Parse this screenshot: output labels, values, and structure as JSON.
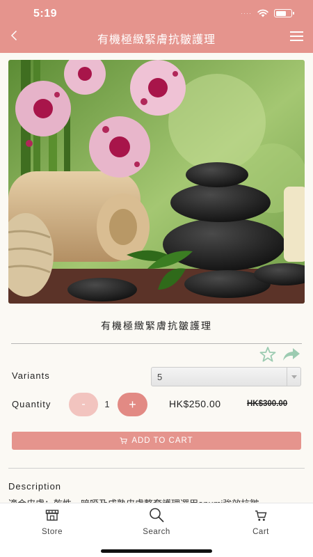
{
  "status_bar": {
    "time": "5:19",
    "signal": "····"
  },
  "header": {
    "title": "有機極緻緊膚抗皺護理"
  },
  "product": {
    "name": "有機極緻緊膚抗皺護理",
    "image": "spa-orchids-stones-towel-photo"
  },
  "actions": {
    "favorite_icon": "star-icon",
    "share_icon": "share-arrow-icon"
  },
  "variants": {
    "label": "Variants",
    "selected": "5"
  },
  "quantity": {
    "label": "Quantity",
    "minus": "-",
    "value": "1",
    "plus": "+"
  },
  "pricing": {
    "price": "HK$250.00",
    "original_price": "HK$300.00"
  },
  "cart_button": {
    "label": "ADD TO CART"
  },
  "description": {
    "heading": "Description",
    "text": "適合皮膚：乾性、暗啞及成熟皮膚整套護理選用anumi強效抗皺"
  },
  "tabs": [
    {
      "label": "Store",
      "icon": "store-icon"
    },
    {
      "label": "Search",
      "icon": "search-icon"
    },
    {
      "label": "Cart",
      "icon": "cart-icon"
    }
  ],
  "colors": {
    "brand": "#e5948d",
    "plus_button": "#e28a84",
    "minus_button": "#f2c4bf",
    "icon_green": "#9ccbb1",
    "background": "#fbf9f4"
  }
}
